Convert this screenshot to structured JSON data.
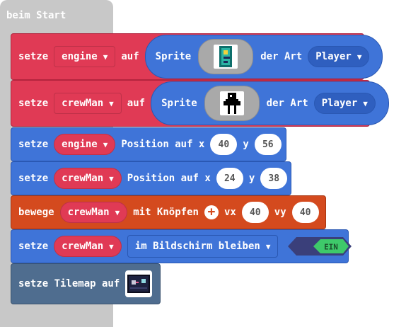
{
  "on_start": {
    "label": "beim Start"
  },
  "blocks": [
    {
      "set": "setze",
      "variable": "engine",
      "to": "auf",
      "sprite": "Sprite",
      "of_kind": "der Art",
      "kind": "Player"
    },
    {
      "set": "setze",
      "variable": "crewMan",
      "to": "auf",
      "sprite": "Sprite",
      "of_kind": "der Art",
      "kind": "Player"
    }
  ],
  "position_blocks": [
    {
      "set": "setze",
      "variable": "engine",
      "label": "Position auf x",
      "x": "40",
      "y_label": "y",
      "y": "56"
    },
    {
      "set": "setze",
      "variable": "crewMan",
      "label": "Position auf x",
      "x": "24",
      "y_label": "y",
      "y": "38"
    }
  ],
  "move_block": {
    "verb": "bewege",
    "variable": "crewMan",
    "label": "mit Knöpfen",
    "vx_label": "vx",
    "vx": "40",
    "vy_label": "vy",
    "vy": "40"
  },
  "stay_block": {
    "set": "setze",
    "variable": "crewMan",
    "option": "im Bildschirm bleiben",
    "toggle": "EIN"
  },
  "tilemap_block": {
    "label": "setze Tilemap auf"
  },
  "colors": {
    "red": "#e03a55",
    "blue": "#3f74d8",
    "orange": "#d44a1e",
    "slate": "#4f6d8f",
    "hat": "#c8c8c8",
    "toggle_on": "#3ec96a"
  }
}
